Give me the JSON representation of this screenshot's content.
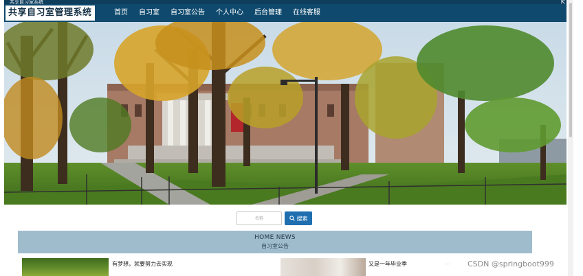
{
  "topbar": {
    "text": "共享自习室系统"
  },
  "brand": {
    "title": "共享自习室管理系统"
  },
  "nav": {
    "items": [
      {
        "label": "首页"
      },
      {
        "label": "自习室"
      },
      {
        "label": "自习室公告"
      },
      {
        "label": "个人中心"
      },
      {
        "label": "后台管理"
      },
      {
        "label": "在线客服"
      }
    ]
  },
  "hero": {
    "description": "campus"
  },
  "search": {
    "placeholder": "名称",
    "button_label": "搜索",
    "icon": "search-icon"
  },
  "news": {
    "title_en": "HOME NEWS",
    "title_cn": "自习室公告",
    "items": [
      {
        "title": "有梦想，就要努力去实现"
      },
      {
        "title": "又是一年毕业季"
      }
    ],
    "date": "..."
  },
  "watermark": {
    "text": "CSDN @springboot999"
  },
  "colors": {
    "navbar": "#0f4a6e",
    "accent": "#1f6fb0",
    "news_header": "#9fbccd"
  }
}
